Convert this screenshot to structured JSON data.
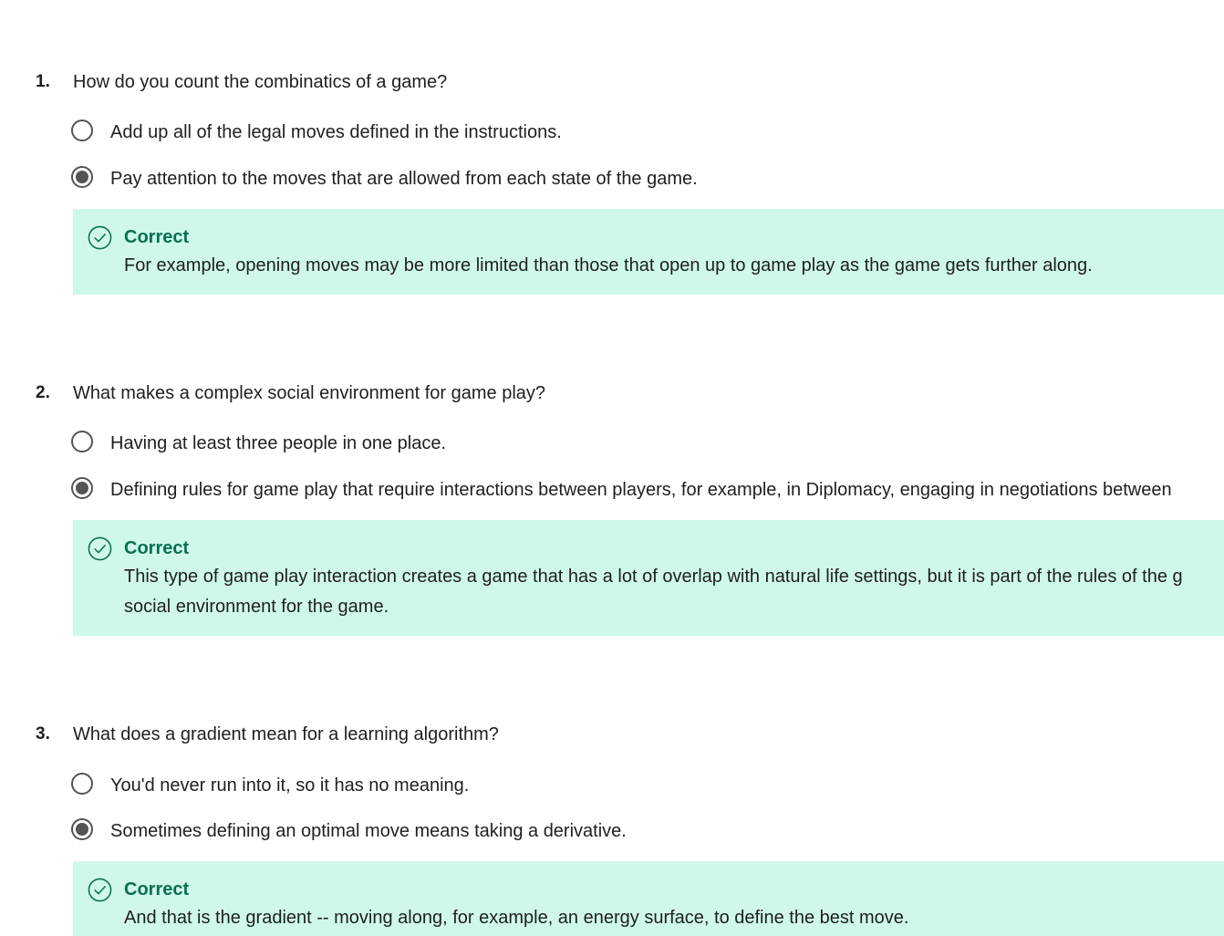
{
  "questions": [
    {
      "number": "1.",
      "text": "How do you count the combinatics of a game?",
      "options": [
        {
          "label": "Add up all of the legal moves defined in the instructions.",
          "selected": false
        },
        {
          "label": "Pay attention to the moves that are allowed from each state of the game.",
          "selected": true
        }
      ],
      "feedback": {
        "status": "Correct",
        "lines": [
          "For example, opening moves may be more limited than those that open up to game play as the game gets further along."
        ]
      }
    },
    {
      "number": "2.",
      "text": "What makes a complex social environment for game play?",
      "options": [
        {
          "label": "Having at least three people in one place.",
          "selected": false
        },
        {
          "label": "Defining rules for game play that require interactions between players, for example, in Diplomacy, engaging in negotiations between",
          "selected": true
        }
      ],
      "feedback": {
        "status": "Correct",
        "lines": [
          "This type of game play interaction creates a game that has a lot of overlap with natural life settings, but it is part of the rules of the g",
          "social environment for the game."
        ]
      }
    },
    {
      "number": "3.",
      "text": "What does a gradient mean for a learning algorithm?",
      "options": [
        {
          "label": "You'd never run into it, so it has no meaning.",
          "selected": false
        },
        {
          "label": "Sometimes defining an optimal move means taking a derivative.",
          "selected": true
        }
      ],
      "feedback": {
        "status": "Correct",
        "lines": [
          "And that is the gradient -- moving along, for example, an energy surface, to define the best move."
        ]
      }
    }
  ],
  "colors": {
    "feedback_background": "#cff8eb",
    "correct_green": "#087051",
    "radio_gray": "#545454",
    "text": "#1f1f1f"
  },
  "icons": {
    "feedback": "check-circle-icon",
    "option": "radio-button-icon"
  }
}
